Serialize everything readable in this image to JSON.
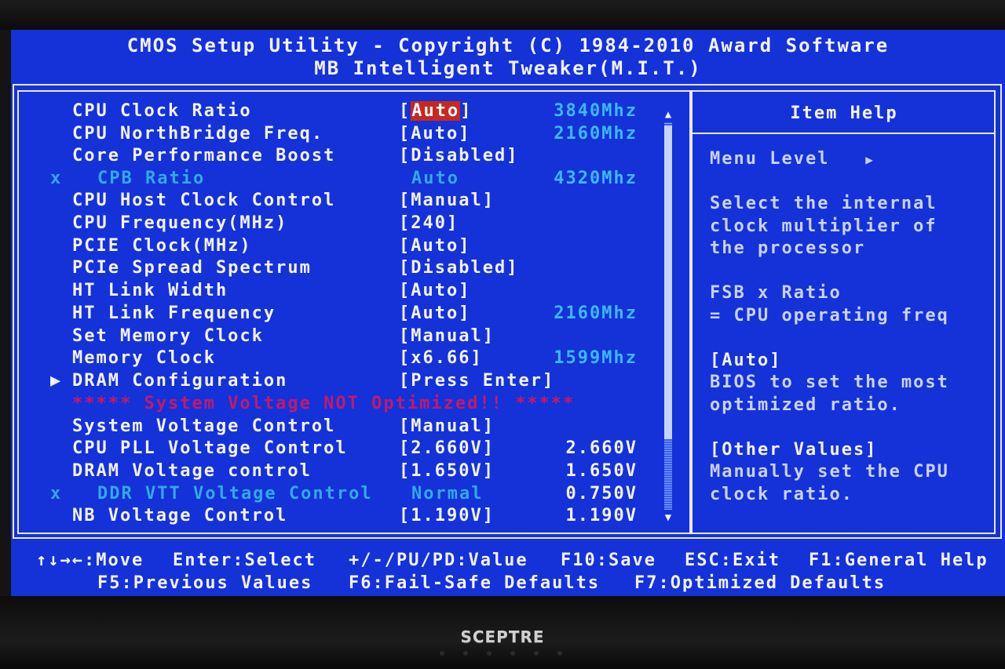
{
  "header": {
    "title_line1": "CMOS Setup Utility - Copyright (C) 1984-2010 Award Software",
    "title_line2": "MB Intelligent Tweaker(M.I.T.)"
  },
  "settings": [
    {
      "mark": "",
      "label": "CPU Clock Ratio",
      "value_prefix": "[",
      "value_highlight": "Auto",
      "value_suffix": "]",
      "info": "3840Mhz",
      "disabled": false
    },
    {
      "mark": "",
      "label": "CPU NorthBridge Freq.",
      "value": "[Auto]",
      "info": "2160Mhz",
      "disabled": false
    },
    {
      "mark": "",
      "label": "Core Performance Boost",
      "value": "[Disabled]",
      "info": "",
      "disabled": false
    },
    {
      "mark": "x",
      "label": "CPB Ratio",
      "value": "Auto",
      "info": "4320Mhz",
      "disabled": true
    },
    {
      "mark": "",
      "label": "CPU Host Clock Control",
      "value": "[Manual]",
      "info": "",
      "disabled": false
    },
    {
      "mark": "",
      "label": "CPU Frequency(MHz)",
      "value": "[240]",
      "info": "",
      "disabled": false
    },
    {
      "mark": "",
      "label": "PCIE Clock(MHz)",
      "value": "[Auto]",
      "info": "",
      "disabled": false
    },
    {
      "mark": "",
      "label": "PCIe Spread Spectrum",
      "value": "[Disabled]",
      "info": "",
      "disabled": false
    },
    {
      "mark": "",
      "label": "HT Link Width",
      "value": "[Auto]",
      "info": "",
      "disabled": false
    },
    {
      "mark": "",
      "label": "HT Link Frequency",
      "value": "[Auto]",
      "info": "2160Mhz",
      "disabled": false
    },
    {
      "mark": "",
      "label": "Set Memory Clock",
      "value": "[Manual]",
      "info": "",
      "disabled": false
    },
    {
      "mark": "",
      "label": "Memory Clock",
      "value": "[x6.66]",
      "info": "1599Mhz",
      "disabled": false
    },
    {
      "mark": "▶",
      "label": "DRAM Configuration",
      "value": "[Press Enter]",
      "info": "",
      "disabled": false
    },
    {
      "mark": "",
      "label": "System Voltage Control",
      "value": "[Manual]",
      "info": "",
      "disabled": false
    },
    {
      "mark": "",
      "label": "CPU PLL Voltage Control",
      "value": "[2.660V]",
      "info_plain": "2.660V",
      "disabled": false
    },
    {
      "mark": "",
      "label": "DRAM Voltage control",
      "value": "[1.650V]",
      "info_plain": "1.650V",
      "disabled": false
    },
    {
      "mark": "x",
      "label": "DDR VTT Voltage Control",
      "value": "Normal",
      "info_plain": "0.750V",
      "disabled": true
    },
    {
      "mark": "",
      "label": "NB Voltage Control",
      "value": "[1.190V]",
      "info_plain": "1.190V",
      "disabled": false
    }
  ],
  "warning": "***** System Voltage NOT Optimized!! *****",
  "scrollbar": {
    "up": "▲",
    "down": "▼"
  },
  "help": {
    "title": "Item Help",
    "menu_level": "Menu Level",
    "menu_level_arrow": "▶",
    "lines": [
      "Select the internal",
      "clock multiplier of",
      "the processor",
      "FSB x Ratio",
      "= CPU operating freq",
      "[Auto]",
      "BIOS to set the most",
      "optimized ratio.",
      "[Other Values]",
      "Manually set the CPU",
      "clock ratio."
    ]
  },
  "footer": {
    "move": "↑↓→←:Move",
    "select": "Enter:Select",
    "value": "+/-/PU/PD:Value",
    "save": "F10:Save",
    "exit": "ESC:Exit",
    "general_help": "F1:General Help",
    "previous_values": "F5:Previous Values",
    "fail_safe": "F6:Fail-Safe Defaults",
    "optimized": "F7:Optimized Defaults"
  },
  "monitor": {
    "brand": "SCEPTRE"
  },
  "colors": {
    "bios_blue": "#1432d8",
    "disabled_cyan": "#33a8e8",
    "warning_magenta": "#c01a6e",
    "highlight_red": "#c8281e"
  }
}
